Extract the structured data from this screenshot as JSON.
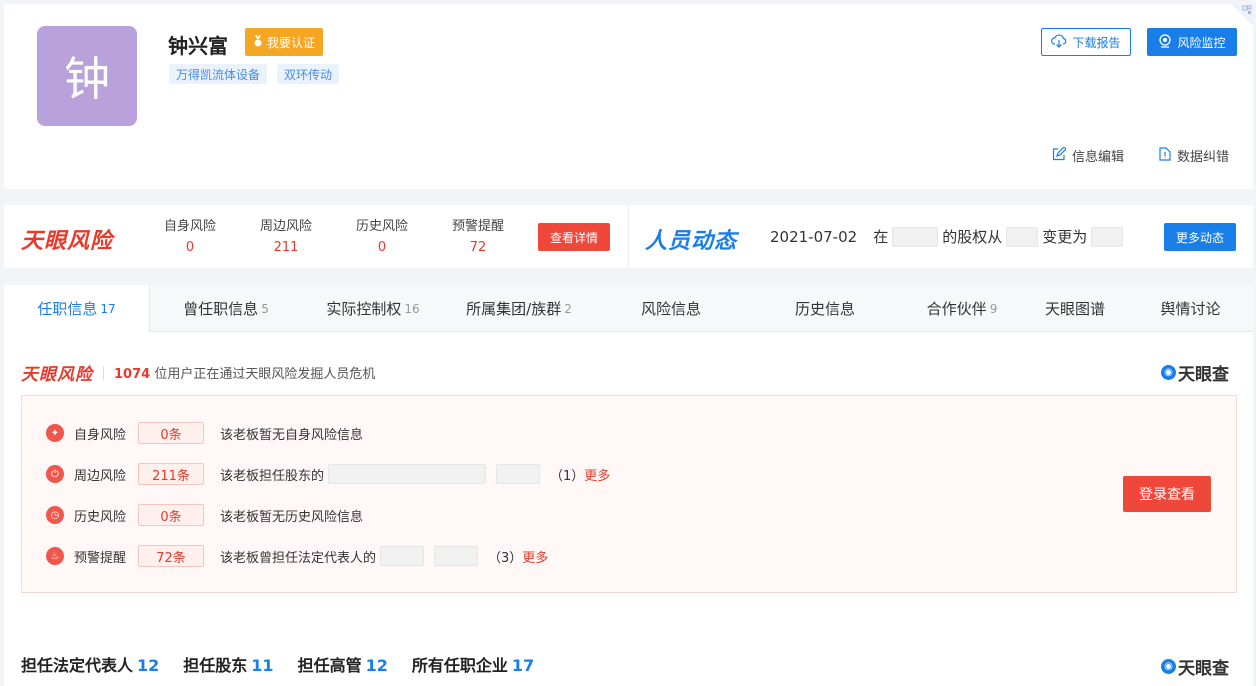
{
  "profile": {
    "avatar_char": "钟",
    "name": "钟兴富",
    "verify_label": "我要认证",
    "tags": [
      "万得凯流体设备",
      "双环传动"
    ],
    "download_label": "下载报告",
    "monitor_label": "风险监控",
    "edit_label": "信息编辑",
    "correct_label": "数据纠错"
  },
  "riskbar": {
    "brand": "天眼风险",
    "stats": [
      {
        "label": "自身风险",
        "value": "0"
      },
      {
        "label": "周边风险",
        "value": "211"
      },
      {
        "label": "历史风险",
        "value": "0"
      },
      {
        "label": "预警提醒",
        "value": "72"
      }
    ],
    "detail_button": "查看详情",
    "dynamics_brand": "人员动态",
    "dynamics_date": "2021-07-02",
    "dyn_in": "在",
    "dyn_equity_from": "的股权从",
    "dyn_changed_to": "变更为",
    "more_button": "更多动态"
  },
  "tabs": [
    {
      "label": "任职信息",
      "count": "17"
    },
    {
      "label": "曾任职信息",
      "count": "5"
    },
    {
      "label": "实际控制权",
      "count": "16"
    },
    {
      "label": "所属集团/族群",
      "count": "2"
    },
    {
      "label": "风险信息",
      "count": ""
    },
    {
      "label": "历史信息",
      "count": ""
    },
    {
      "label": "合作伙伴",
      "count": "9"
    },
    {
      "label": "天眼图谱",
      "count": ""
    },
    {
      "label": "舆情讨论",
      "count": ""
    }
  ],
  "risk_panel": {
    "brand": "天眼风险",
    "users_count": "1074",
    "users_text": "位用户正在通过天眼风险发掘人员危机",
    "logo_text": "天眼查",
    "rows": [
      {
        "name": "自身风险",
        "count": "0条",
        "desc": "该老板暂无自身风险信息",
        "suffix": "",
        "more": ""
      },
      {
        "name": "周边风险",
        "count": "211条",
        "desc": "该老板担任股东的",
        "suffix": "（1）",
        "more": "更多"
      },
      {
        "name": "历史风险",
        "count": "0条",
        "desc": "该老板暂无历史风险信息",
        "suffix": "",
        "more": ""
      },
      {
        "name": "预警提醒",
        "count": "72条",
        "desc": "该老板曾担任法定代表人的",
        "suffix": "（3）",
        "more": "更多"
      }
    ],
    "login_button": "登录查看"
  },
  "summary": {
    "items": [
      {
        "label": "担任法定代表人",
        "count": "12"
      },
      {
        "label": "担任股东",
        "count": "11"
      },
      {
        "label": "担任高管",
        "count": "12"
      },
      {
        "label": "所有任职企业",
        "count": "17"
      }
    ],
    "logo_text": "天眼查"
  },
  "colors": {
    "accent_blue": "#1a7ee8",
    "risk_red": "#e8392a",
    "avatar_bg": "#b9a2db",
    "verify_orange": "#f5a623"
  }
}
